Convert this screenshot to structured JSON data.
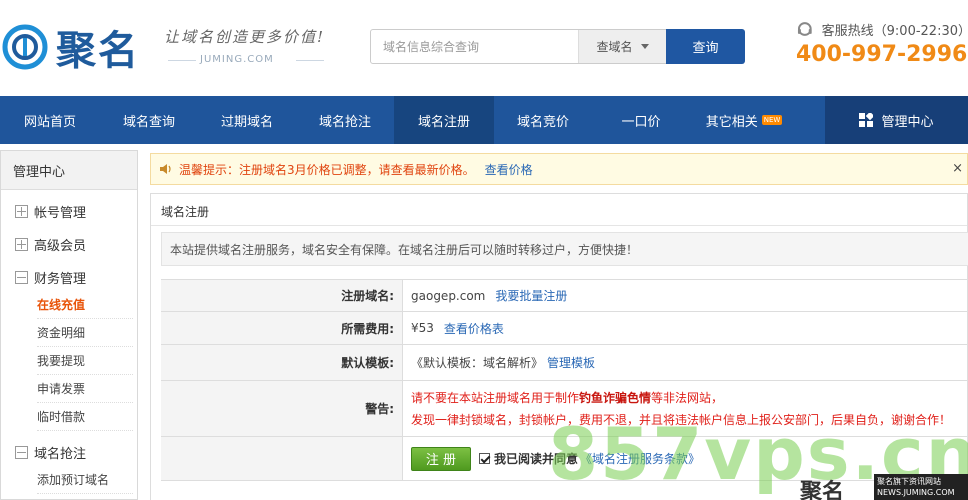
{
  "header": {
    "logo_text": "聚名",
    "slogan": "让域名创造更多价值!",
    "site": "JUMING.COM",
    "search": {
      "placeholder": "域名信息综合查询",
      "select_label": "查域名",
      "button_label": "查询"
    },
    "hotline_label": "客服热线（9:00-22:30）",
    "phone": "400-997-2996"
  },
  "nav": {
    "items": [
      "网站首页",
      "域名查询",
      "过期域名",
      "域名抢注",
      "域名注册",
      "域名竞价",
      "一口价",
      "其它相关"
    ],
    "new_badge": "NEW",
    "admin_label": "管理中心",
    "active_index": 4
  },
  "sidebar": {
    "title": "管理中心",
    "groups": [
      "帐号管理",
      "高级会员",
      "财务管理",
      "域名抢注"
    ],
    "finance_items": [
      "在线充值",
      "资金明细",
      "我要提现",
      "申请发票",
      "临时借款"
    ],
    "snatch_items": [
      "添加预订域名"
    ]
  },
  "notice": {
    "text": "温馨提示：注册域名3月价格已调整，请查看最新价格。",
    "link": "查看价格",
    "close": "×"
  },
  "panel": {
    "title": "域名注册",
    "info": "本站提供域名注册服务，域名安全有保障。在域名注册后可以随时转移过户，方便快捷！",
    "rows": {
      "domain_label": "注册域名:",
      "domain_value": "gaogep.com",
      "domain_link": "我要批量注册",
      "fee_label": "所需费用:",
      "fee_value": "¥53",
      "fee_link": "查看价格表",
      "template_label": "默认模板:",
      "template_value": "《默认模板：域名解析》",
      "template_link": "管理模板",
      "warning_label": "警告:",
      "warning_line1_a": "请不要在本站注册域名用于制作",
      "warning_line1_b": "钓鱼诈骗色情",
      "warning_line1_c": "等非法网站，",
      "warning_line2": "发现一律封锁域名，封锁帐户，费用不退，并且将违法帐户信息上报公安部门，后果自负，谢谢合作！"
    },
    "submit_label": "注 册",
    "agree_text": "我已阅读并同意",
    "terms_link": "《域名注册服务条款》"
  },
  "watermark": {
    "text": "857vps.cn",
    "logo": "聚名",
    "tag_line1": "聚名旗下资讯网站",
    "tag_line2": "NEWS.JUMING.COM"
  },
  "colors": {
    "nav": "#1f559b",
    "accent": "#f08a16",
    "warning": "#e0201a",
    "link": "#2a68b5"
  }
}
